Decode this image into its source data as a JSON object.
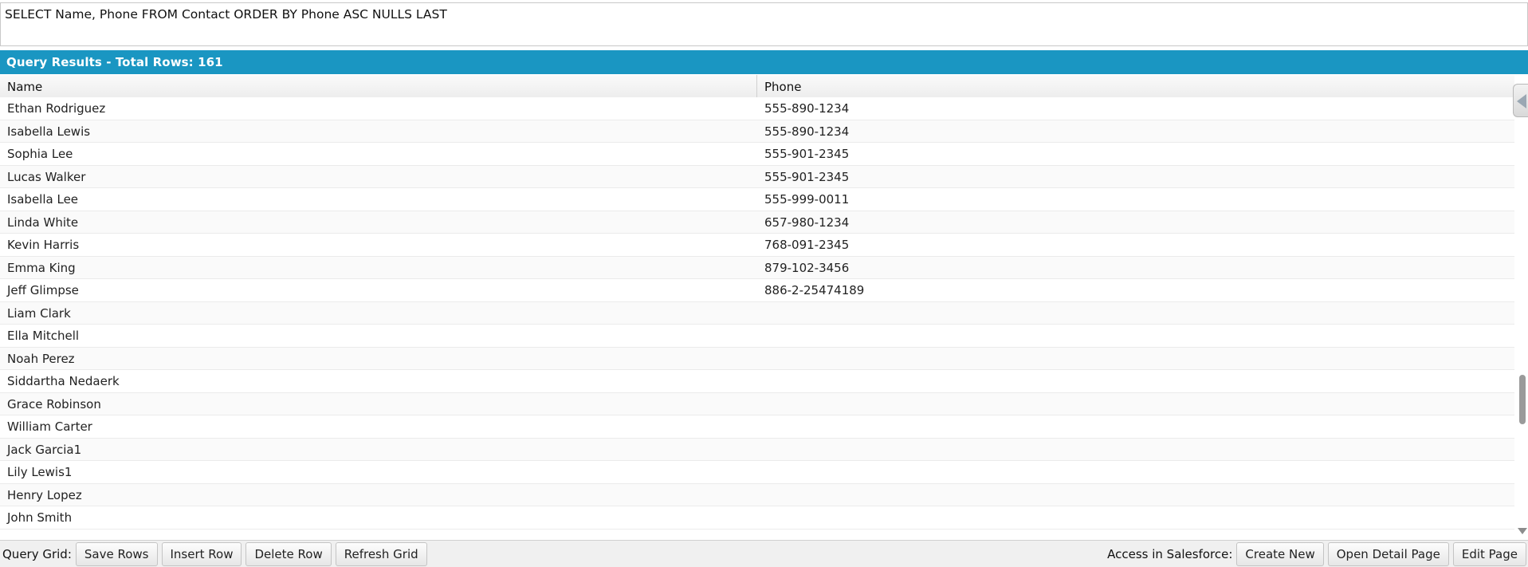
{
  "query": {
    "text": "SELECT Name, Phone FROM Contact ORDER BY Phone ASC NULLS LAST"
  },
  "results": {
    "title": "Query Results - Total Rows: 161",
    "columns": [
      "Name",
      "Phone"
    ],
    "rows": [
      {
        "name": "Ethan Rodriguez",
        "phone": "555-890-1234"
      },
      {
        "name": "Isabella Lewis",
        "phone": "555-890-1234"
      },
      {
        "name": "Sophia Lee",
        "phone": "555-901-2345"
      },
      {
        "name": "Lucas Walker",
        "phone": "555-901-2345"
      },
      {
        "name": "Isabella Lee",
        "phone": "555-999-0011"
      },
      {
        "name": "Linda White",
        "phone": "657-980-1234"
      },
      {
        "name": "Kevin Harris",
        "phone": "768-091-2345"
      },
      {
        "name": "Emma King",
        "phone": "879-102-3456"
      },
      {
        "name": "Jeff Glimpse",
        "phone": "886-2-25474189"
      },
      {
        "name": "Liam Clark",
        "phone": ""
      },
      {
        "name": "Ella Mitchell",
        "phone": ""
      },
      {
        "name": "Noah Perez",
        "phone": ""
      },
      {
        "name": "Siddartha Nedaerk",
        "phone": ""
      },
      {
        "name": "Grace Robinson",
        "phone": ""
      },
      {
        "name": "William Carter",
        "phone": ""
      },
      {
        "name": "Jack Garcia1",
        "phone": ""
      },
      {
        "name": "Lily Lewis1",
        "phone": ""
      },
      {
        "name": "Henry Lopez",
        "phone": ""
      },
      {
        "name": "John Smith",
        "phone": ""
      }
    ]
  },
  "toolbar": {
    "grid_label": "Query Grid:",
    "save_rows": "Save Rows",
    "insert_row": "Insert Row",
    "delete_row": "Delete Row",
    "refresh_grid": "Refresh Grid",
    "access_label": "Access in Salesforce:",
    "create_new": "Create New",
    "open_detail": "Open Detail Page",
    "edit_page": "Edit Page"
  }
}
